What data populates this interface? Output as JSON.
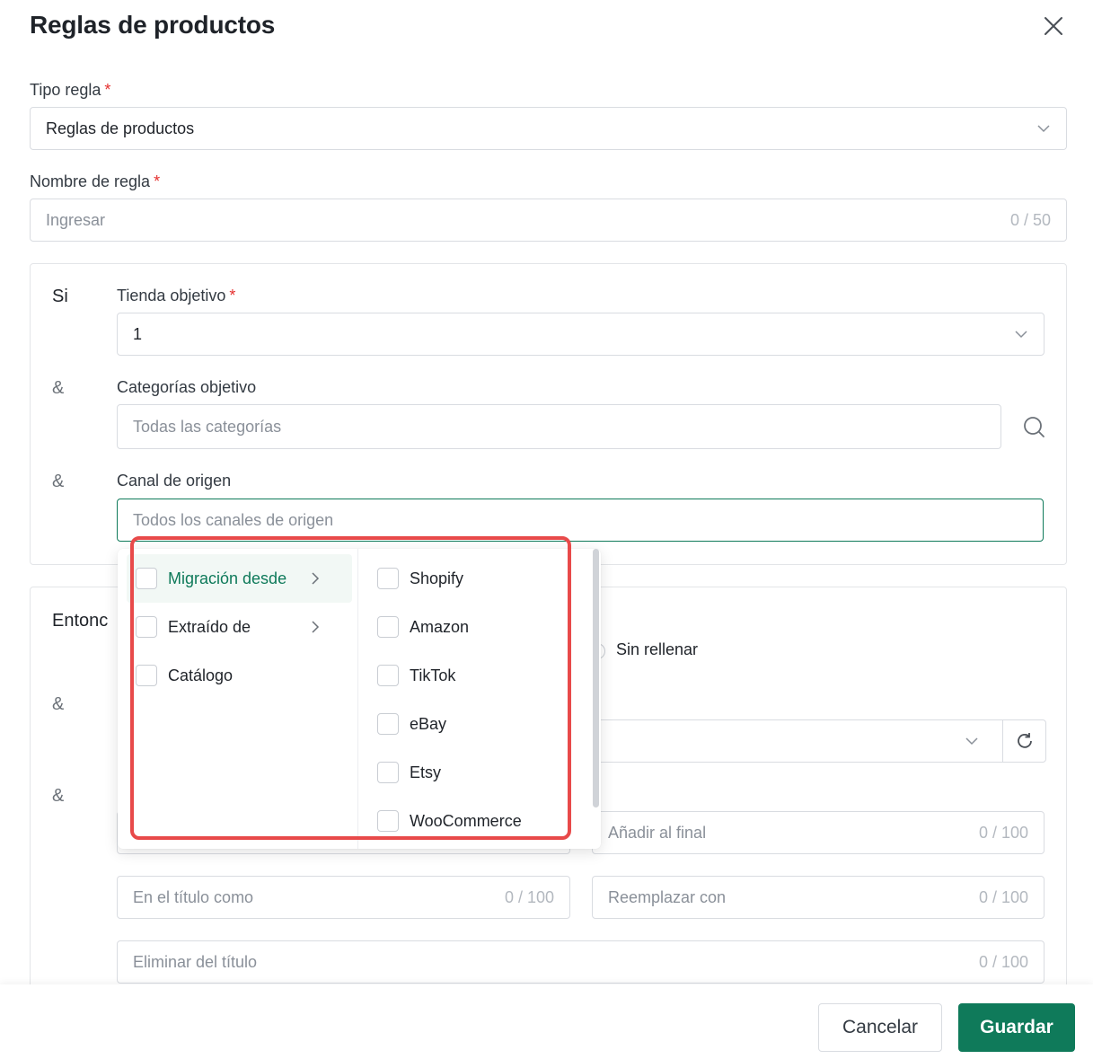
{
  "modal": {
    "title": "Reglas de productos"
  },
  "rule_type": {
    "label": "Tipo regla",
    "required_mark": "*",
    "value": "Reglas de productos"
  },
  "rule_name": {
    "label": "Nombre de regla",
    "required_mark": "*",
    "placeholder": "Ingresar",
    "counter": "0 / 50"
  },
  "if_section": {
    "word": "Si",
    "amp": "&",
    "target_store": {
      "label": "Tienda objetivo",
      "required_mark": "*",
      "value": "1"
    },
    "target_categories": {
      "label": "Categorías objetivo",
      "placeholder": "Todas las categorías"
    },
    "source_channel": {
      "label": "Canal de origen",
      "placeholder": "Todos los canales de origen"
    }
  },
  "then_section": {
    "word": "Entonc",
    "amp": "&",
    "radio_label": "Sin rellenar",
    "append_end": {
      "placeholder": "Añadir al final",
      "counter": "0 / 100"
    },
    "title_as": {
      "placeholder": "En el título como",
      "counter": "0 / 100"
    },
    "replace_with": {
      "placeholder": "Reemplazar con",
      "counter": "0 / 100"
    },
    "remove_title": {
      "placeholder": "Eliminar del título",
      "counter": "0 / 100"
    }
  },
  "cascader": {
    "left": [
      {
        "label": "Migración desde",
        "has_children": true,
        "active": true
      },
      {
        "label": "Extraído de",
        "has_children": true,
        "active": false
      },
      {
        "label": "Catálogo",
        "has_children": false,
        "active": false
      }
    ],
    "right": [
      {
        "label": "Shopify"
      },
      {
        "label": "Amazon"
      },
      {
        "label": "TikTok"
      },
      {
        "label": "eBay"
      },
      {
        "label": "Etsy"
      },
      {
        "label": "WooCommerce"
      }
    ]
  },
  "footer": {
    "cancel_label": "Cancelar",
    "save_label": "Guardar"
  },
  "colors": {
    "accent": "#0f7a5a",
    "required": "#e5302f",
    "highlight": "#e84a4a"
  }
}
